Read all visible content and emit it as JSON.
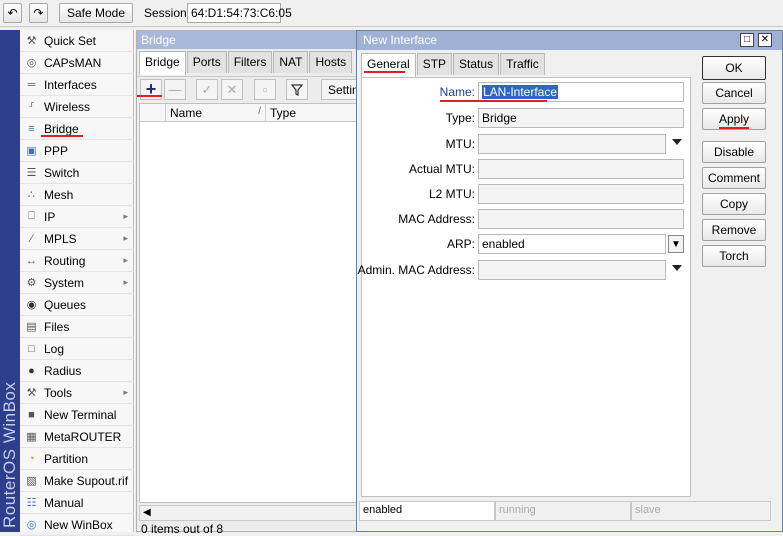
{
  "toolbar": {
    "safe_mode_label": "Safe Mode",
    "session_label": "Session:",
    "session_value": "64:D1:54:73:C6:05"
  },
  "brand": {
    "text": "RouterOS WinBox"
  },
  "menu": {
    "items": [
      {
        "label": "Quick Set",
        "icon": "quick-set-icon",
        "submenu": false
      },
      {
        "label": "CAPsMAN",
        "icon": "capsman-icon",
        "submenu": false
      },
      {
        "label": "Interfaces",
        "icon": "interfaces-icon",
        "submenu": false
      },
      {
        "label": "Wireless",
        "icon": "wireless-icon",
        "submenu": false
      },
      {
        "label": "Bridge",
        "icon": "bridge-icon",
        "submenu": false
      },
      {
        "label": "PPP",
        "icon": "ppp-icon",
        "submenu": false
      },
      {
        "label": "Switch",
        "icon": "switch-icon",
        "submenu": false
      },
      {
        "label": "Mesh",
        "icon": "mesh-icon",
        "submenu": false
      },
      {
        "label": "IP",
        "icon": "ip-icon",
        "submenu": true
      },
      {
        "label": "MPLS",
        "icon": "mpls-icon",
        "submenu": true
      },
      {
        "label": "Routing",
        "icon": "routing-icon",
        "submenu": true
      },
      {
        "label": "System",
        "icon": "system-icon",
        "submenu": true
      },
      {
        "label": "Queues",
        "icon": "queues-icon",
        "submenu": false
      },
      {
        "label": "Files",
        "icon": "files-icon",
        "submenu": false
      },
      {
        "label": "Log",
        "icon": "log-icon",
        "submenu": false
      },
      {
        "label": "Radius",
        "icon": "radius-icon",
        "submenu": false
      },
      {
        "label": "Tools",
        "icon": "tools-icon",
        "submenu": true
      },
      {
        "label": "New Terminal",
        "icon": "terminal-icon",
        "submenu": false
      },
      {
        "label": "MetaROUTER",
        "icon": "metarouter-icon",
        "submenu": false
      },
      {
        "label": "Partition",
        "icon": "partition-icon",
        "submenu": false
      },
      {
        "label": "Make Supout.rif",
        "icon": "supout-icon",
        "submenu": false
      },
      {
        "label": "Manual",
        "icon": "manual-icon",
        "submenu": false
      },
      {
        "label": "New WinBox",
        "icon": "new-winbox-icon",
        "submenu": false
      }
    ]
  },
  "bridge_window": {
    "title": "Bridge",
    "tabs": [
      "Bridge",
      "Ports",
      "Filters",
      "NAT",
      "Hosts"
    ],
    "settings_label": "Settings",
    "columns": [
      "Name",
      "Type"
    ],
    "items_count": "0 items out of 8"
  },
  "dialog": {
    "title": "New Interface",
    "tabs": [
      "General",
      "STP",
      "Status",
      "Traffic"
    ],
    "fields": {
      "name_label": "Name:",
      "name_value": "LAN-Interface",
      "type_label": "Type:",
      "type_value": "Bridge",
      "mtu_label": "MTU:",
      "mtu_value": "",
      "actual_mtu_label": "Actual MTU:",
      "actual_mtu_value": "",
      "l2_mtu_label": "L2 MTU:",
      "l2_mtu_value": "",
      "mac_label": "MAC Address:",
      "mac_value": "",
      "arp_label": "ARP:",
      "arp_value": "enabled",
      "admin_mac_label": "Admin. MAC Address:",
      "admin_mac_value": ""
    },
    "buttons": [
      "OK",
      "Cancel",
      "Apply",
      "Disable",
      "Comment",
      "Copy",
      "Remove",
      "Torch"
    ],
    "status": {
      "enabled": "enabled",
      "running": "running",
      "slave": "slave"
    }
  },
  "colors": {
    "annotation_red": "#e02020",
    "title_bar": "#9fb2d6",
    "selection": "#2f65c7",
    "brand_band": "#2c3e8c"
  }
}
